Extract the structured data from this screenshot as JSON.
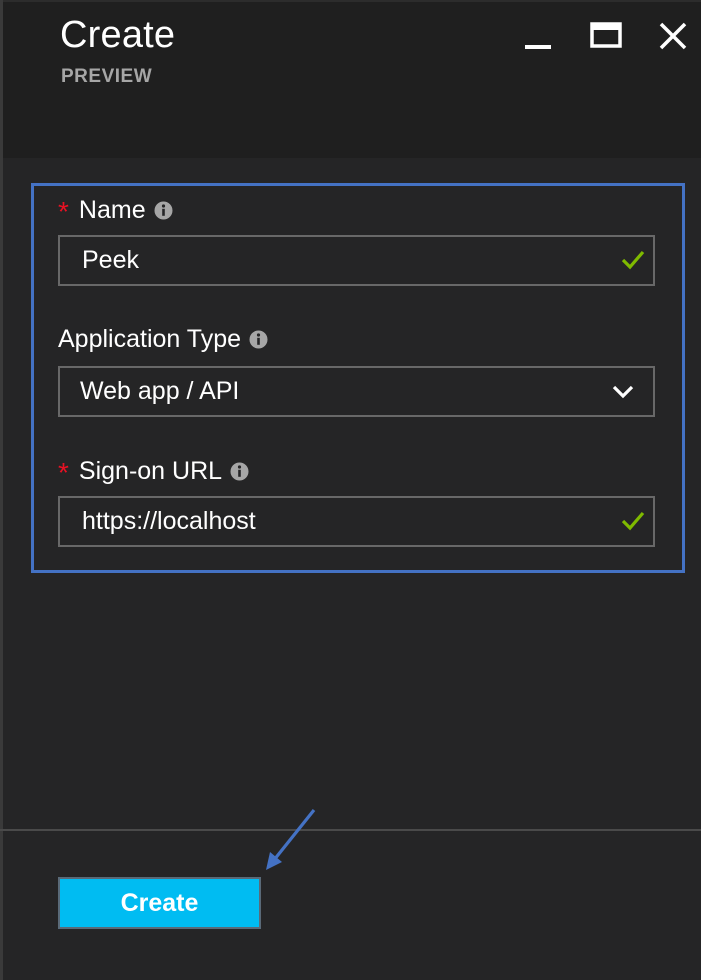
{
  "header": {
    "title": "Create",
    "subtitle": "PREVIEW",
    "controls": {
      "minimize_icon": "minimize-icon",
      "maximize_icon": "maximize-icon",
      "close_icon": "close-icon"
    }
  },
  "form": {
    "name": {
      "label": "Name",
      "required": true,
      "value": "Peek",
      "valid": true
    },
    "application_type": {
      "label": "Application Type",
      "required": false,
      "value": "Web app / API"
    },
    "sign_on_url": {
      "label": "Sign-on URL",
      "required": true,
      "value": "https://localhost",
      "valid": true
    },
    "required_marker": "*"
  },
  "footer": {
    "create_label": "Create"
  },
  "colors": {
    "background": "#252526",
    "header_background": "#1f1f1f",
    "highlight_border": "#4472c4",
    "required_star": "#e81123",
    "valid_check": "#7fba00",
    "primary_button": "#00bcf2",
    "input_border": "#686868"
  }
}
